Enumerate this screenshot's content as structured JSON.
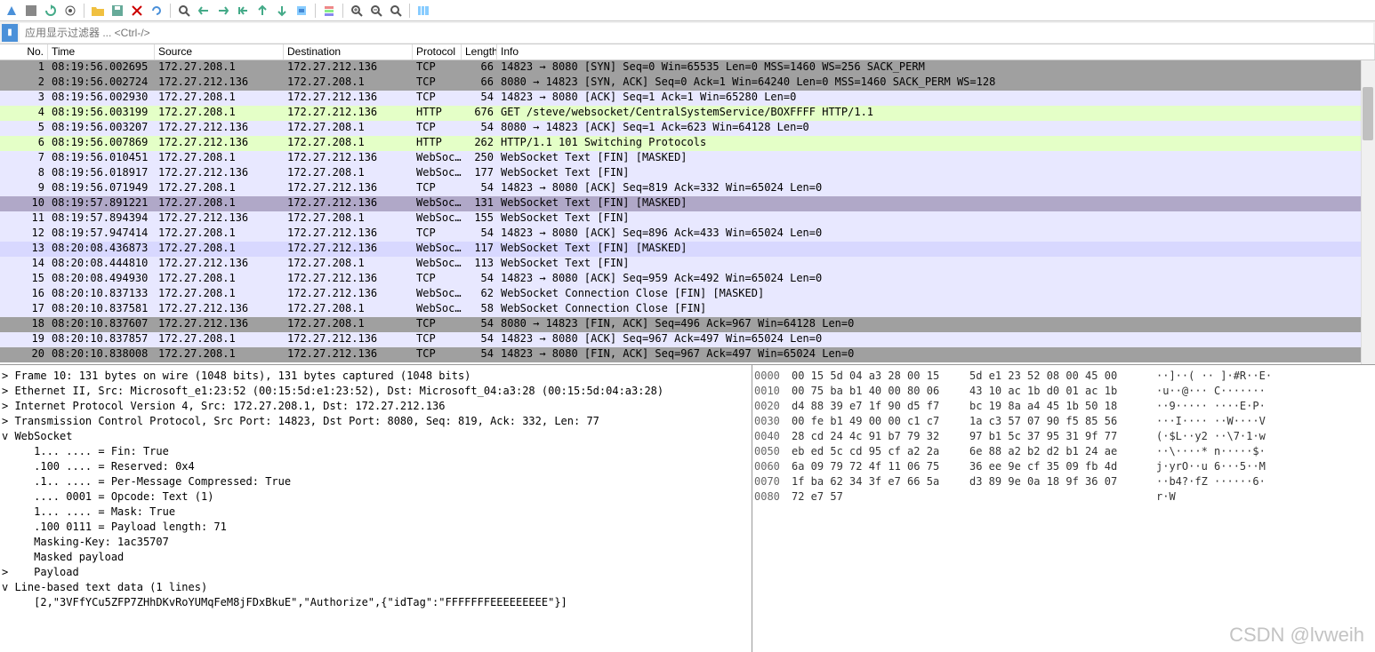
{
  "filter": {
    "placeholder": "应用显示过滤器 ... <Ctrl-/>"
  },
  "columns": {
    "no": "No.",
    "time": "Time",
    "source": "Source",
    "destination": "Destination",
    "protocol": "Protocol",
    "length": "Length",
    "info": "Info"
  },
  "packets": [
    {
      "no": "1",
      "time": "08:19:56.002695",
      "src": "172.27.208.1",
      "dst": "172.27.212.136",
      "proto": "TCP",
      "len": "66",
      "info": "14823 → 8080 [SYN] Seq=0 Win=65535 Len=0 MSS=1460 WS=256 SACK_PERM",
      "bg": "#a0a0a0",
      "fg": "#000"
    },
    {
      "no": "2",
      "time": "08:19:56.002724",
      "src": "172.27.212.136",
      "dst": "172.27.208.1",
      "proto": "TCP",
      "len": "66",
      "info": "8080 → 14823 [SYN, ACK] Seq=0 Ack=1 Win=64240 Len=0 MSS=1460 SACK_PERM WS=128",
      "bg": "#a0a0a0",
      "fg": "#000"
    },
    {
      "no": "3",
      "time": "08:19:56.002930",
      "src": "172.27.208.1",
      "dst": "172.27.212.136",
      "proto": "TCP",
      "len": "54",
      "info": "14823 → 8080 [ACK] Seq=1 Ack=1 Win=65280 Len=0",
      "bg": "#e8e8ff",
      "fg": "#000"
    },
    {
      "no": "4",
      "time": "08:19:56.003199",
      "src": "172.27.208.1",
      "dst": "172.27.212.136",
      "proto": "HTTP",
      "len": "676",
      "info": "GET /steve/websocket/CentralSystemService/BOXFFFF HTTP/1.1",
      "bg": "#e4ffc7",
      "fg": "#000"
    },
    {
      "no": "5",
      "time": "08:19:56.003207",
      "src": "172.27.212.136",
      "dst": "172.27.208.1",
      "proto": "TCP",
      "len": "54",
      "info": "8080 → 14823 [ACK] Seq=1 Ack=623 Win=64128 Len=0",
      "bg": "#e8e8ff",
      "fg": "#000"
    },
    {
      "no": "6",
      "time": "08:19:56.007869",
      "src": "172.27.212.136",
      "dst": "172.27.208.1",
      "proto": "HTTP",
      "len": "262",
      "info": "HTTP/1.1 101 Switching Protocols",
      "bg": "#e4ffc7",
      "fg": "#000"
    },
    {
      "no": "7",
      "time": "08:19:56.010451",
      "src": "172.27.208.1",
      "dst": "172.27.212.136",
      "proto": "WebSoc…",
      "len": "250",
      "info": "WebSocket Text [FIN] [MASKED]",
      "bg": "#e8e8ff",
      "fg": "#000"
    },
    {
      "no": "8",
      "time": "08:19:56.018917",
      "src": "172.27.212.136",
      "dst": "172.27.208.1",
      "proto": "WebSoc…",
      "len": "177",
      "info": "WebSocket Text [FIN]",
      "bg": "#e8e8ff",
      "fg": "#000"
    },
    {
      "no": "9",
      "time": "08:19:56.071949",
      "src": "172.27.208.1",
      "dst": "172.27.212.136",
      "proto": "TCP",
      "len": "54",
      "info": "14823 → 8080 [ACK] Seq=819 Ack=332 Win=65024 Len=0",
      "bg": "#e8e8ff",
      "fg": "#000"
    },
    {
      "no": "10",
      "time": "08:19:57.891221",
      "src": "172.27.208.1",
      "dst": "172.27.212.136",
      "proto": "WebSoc…",
      "len": "131",
      "info": "WebSocket Text [FIN] [MASKED]",
      "bg": "#b0a8c8",
      "fg": "#000"
    },
    {
      "no": "11",
      "time": "08:19:57.894394",
      "src": "172.27.212.136",
      "dst": "172.27.208.1",
      "proto": "WebSoc…",
      "len": "155",
      "info": "WebSocket Text [FIN]",
      "bg": "#e8e8ff",
      "fg": "#000"
    },
    {
      "no": "12",
      "time": "08:19:57.947414",
      "src": "172.27.208.1",
      "dst": "172.27.212.136",
      "proto": "TCP",
      "len": "54",
      "info": "14823 → 8080 [ACK] Seq=896 Ack=433 Win=65024 Len=0",
      "bg": "#e8e8ff",
      "fg": "#000"
    },
    {
      "no": "13",
      "time": "08:20:08.436873",
      "src": "172.27.208.1",
      "dst": "172.27.212.136",
      "proto": "WebSoc…",
      "len": "117",
      "info": "WebSocket Text [FIN] [MASKED]",
      "bg": "#d8d8ff",
      "fg": "#000"
    },
    {
      "no": "14",
      "time": "08:20:08.444810",
      "src": "172.27.212.136",
      "dst": "172.27.208.1",
      "proto": "WebSoc…",
      "len": "113",
      "info": "WebSocket Text [FIN]",
      "bg": "#e8e8ff",
      "fg": "#000"
    },
    {
      "no": "15",
      "time": "08:20:08.494930",
      "src": "172.27.208.1",
      "dst": "172.27.212.136",
      "proto": "TCP",
      "len": "54",
      "info": "14823 → 8080 [ACK] Seq=959 Ack=492 Win=65024 Len=0",
      "bg": "#e8e8ff",
      "fg": "#000"
    },
    {
      "no": "16",
      "time": "08:20:10.837133",
      "src": "172.27.208.1",
      "dst": "172.27.212.136",
      "proto": "WebSoc…",
      "len": "62",
      "info": "WebSocket Connection Close [FIN] [MASKED]",
      "bg": "#e8e8ff",
      "fg": "#000"
    },
    {
      "no": "17",
      "time": "08:20:10.837581",
      "src": "172.27.212.136",
      "dst": "172.27.208.1",
      "proto": "WebSoc…",
      "len": "58",
      "info": "WebSocket Connection Close [FIN]",
      "bg": "#e8e8ff",
      "fg": "#000"
    },
    {
      "no": "18",
      "time": "08:20:10.837607",
      "src": "172.27.212.136",
      "dst": "172.27.208.1",
      "proto": "TCP",
      "len": "54",
      "info": "8080 → 14823 [FIN, ACK] Seq=496 Ack=967 Win=64128 Len=0",
      "bg": "#a0a0a0",
      "fg": "#000"
    },
    {
      "no": "19",
      "time": "08:20:10.837857",
      "src": "172.27.208.1",
      "dst": "172.27.212.136",
      "proto": "TCP",
      "len": "54",
      "info": "14823 → 8080 [ACK] Seq=967 Ack=497 Win=65024 Len=0",
      "bg": "#e8e8ff",
      "fg": "#000"
    },
    {
      "no": "20",
      "time": "08:20:10.838008",
      "src": "172.27.208.1",
      "dst": "172.27.212.136",
      "proto": "TCP",
      "len": "54",
      "info": "14823 → 8080 [FIN, ACK] Seq=967 Ack=497 Win=65024 Len=0",
      "bg": "#a0a0a0",
      "fg": "#000"
    }
  ],
  "details": [
    {
      "indent": 0,
      "exp": ">",
      "text": "Frame 10: 131 bytes on wire (1048 bits), 131 bytes captured (1048 bits)"
    },
    {
      "indent": 0,
      "exp": ">",
      "text": "Ethernet II, Src: Microsoft_e1:23:52 (00:15:5d:e1:23:52), Dst: Microsoft_04:a3:28 (00:15:5d:04:a3:28)"
    },
    {
      "indent": 0,
      "exp": ">",
      "text": "Internet Protocol Version 4, Src: 172.27.208.1, Dst: 172.27.212.136"
    },
    {
      "indent": 0,
      "exp": ">",
      "text": "Transmission Control Protocol, Src Port: 14823, Dst Port: 8080, Seq: 819, Ack: 332, Len: 77"
    },
    {
      "indent": 0,
      "exp": "v",
      "text": "WebSocket"
    },
    {
      "indent": 1,
      "exp": " ",
      "text": "1... .... = Fin: True"
    },
    {
      "indent": 1,
      "exp": " ",
      "text": ".100 .... = Reserved: 0x4"
    },
    {
      "indent": 1,
      "exp": " ",
      "text": ".1.. .... = Per-Message Compressed: True"
    },
    {
      "indent": 1,
      "exp": " ",
      "text": ".... 0001 = Opcode: Text (1)"
    },
    {
      "indent": 1,
      "exp": " ",
      "text": "1... .... = Mask: True"
    },
    {
      "indent": 1,
      "exp": " ",
      "text": ".100 0111 = Payload length: 71"
    },
    {
      "indent": 1,
      "exp": " ",
      "text": "Masking-Key: 1ac35707"
    },
    {
      "indent": 1,
      "exp": " ",
      "text": "Masked payload"
    },
    {
      "indent": 1,
      "exp": ">",
      "text": "Payload"
    },
    {
      "indent": 0,
      "exp": "v",
      "text": "Line-based text data (1 lines)"
    },
    {
      "indent": 1,
      "exp": " ",
      "text": "[2,\"3VFfYCu5ZFP7ZHhDKvRoYUMqFeM8jFDxBkuE\",\"Authorize\",{\"idTag\":\"FFFFFFFEEEEEEEEE\"}]"
    }
  ],
  "hex": [
    {
      "off": "0000",
      "b1": "00 15 5d 04 a3 28 00 15",
      "b2": "5d e1 23 52 08 00 45 00",
      "asc": "··]··( ·· ]·#R··E·"
    },
    {
      "off": "0010",
      "b1": "00 75 ba b1 40 00 80 06",
      "b2": "43 10 ac 1b d0 01 ac 1b",
      "asc": "·u··@··· C·······"
    },
    {
      "off": "0020",
      "b1": "d4 88 39 e7 1f 90 d5 f7",
      "b2": "bc 19 8a a4 45 1b 50 18",
      "asc": "··9····· ····E·P·"
    },
    {
      "off": "0030",
      "b1": "00 fe b1 49 00 00 c1 c7",
      "b2": "1a c3 57 07 90 f5 85 56",
      "asc": "···I···· ··W····V"
    },
    {
      "off": "0040",
      "b1": "28 cd 24 4c 91 b7 79 32",
      "b2": "97 b1 5c 37 95 31 9f 77",
      "asc": "(·$L··y2 ··\\7·1·w"
    },
    {
      "off": "0050",
      "b1": "eb ed 5c cd 95 cf a2 2a",
      "b2": "6e 88 a2 b2 d2 b1 24 ae",
      "asc": "··\\····* n·····$·"
    },
    {
      "off": "0060",
      "b1": "6a 09 79 72 4f 11 06 75",
      "b2": "36 ee 9e cf 35 09 fb 4d",
      "asc": "j·yrO··u 6···5··M"
    },
    {
      "off": "0070",
      "b1": "1f ba 62 34 3f e7 66 5a",
      "b2": "d3 89 9e 0a 18 9f 36 07",
      "asc": "··b4?·fZ ······6·"
    },
    {
      "off": "0080",
      "b1": "72 e7 57",
      "b2": "",
      "asc": "r·W"
    }
  ],
  "watermark": "CSDN @lvweih"
}
